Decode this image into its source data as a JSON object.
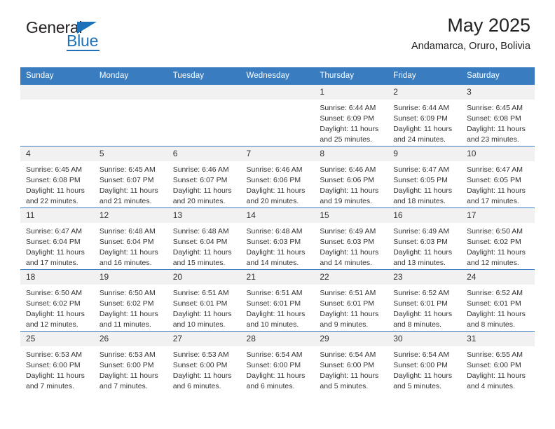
{
  "logo": {
    "word_top": "General",
    "word_bottom": "Blue",
    "triangle_color": "#1d71b8"
  },
  "header": {
    "title": "May 2025",
    "subtitle": "Andamarca, Oruro, Bolivia",
    "accent_color": "#3a7cc0"
  },
  "calendar": {
    "weekday_headers": [
      "Sunday",
      "Monday",
      "Tuesday",
      "Wednesday",
      "Thursday",
      "Friday",
      "Saturday"
    ],
    "weeks": [
      [
        {
          "day": "",
          "lines": []
        },
        {
          "day": "",
          "lines": []
        },
        {
          "day": "",
          "lines": []
        },
        {
          "day": "",
          "lines": []
        },
        {
          "day": "1",
          "lines": [
            "Sunrise: 6:44 AM",
            "Sunset: 6:09 PM",
            "Daylight: 11 hours",
            "and 25 minutes."
          ]
        },
        {
          "day": "2",
          "lines": [
            "Sunrise: 6:44 AM",
            "Sunset: 6:09 PM",
            "Daylight: 11 hours",
            "and 24 minutes."
          ]
        },
        {
          "day": "3",
          "lines": [
            "Sunrise: 6:45 AM",
            "Sunset: 6:08 PM",
            "Daylight: 11 hours",
            "and 23 minutes."
          ]
        }
      ],
      [
        {
          "day": "4",
          "lines": [
            "Sunrise: 6:45 AM",
            "Sunset: 6:08 PM",
            "Daylight: 11 hours",
            "and 22 minutes."
          ]
        },
        {
          "day": "5",
          "lines": [
            "Sunrise: 6:45 AM",
            "Sunset: 6:07 PM",
            "Daylight: 11 hours",
            "and 21 minutes."
          ]
        },
        {
          "day": "6",
          "lines": [
            "Sunrise: 6:46 AM",
            "Sunset: 6:07 PM",
            "Daylight: 11 hours",
            "and 20 minutes."
          ]
        },
        {
          "day": "7",
          "lines": [
            "Sunrise: 6:46 AM",
            "Sunset: 6:06 PM",
            "Daylight: 11 hours",
            "and 20 minutes."
          ]
        },
        {
          "day": "8",
          "lines": [
            "Sunrise: 6:46 AM",
            "Sunset: 6:06 PM",
            "Daylight: 11 hours",
            "and 19 minutes."
          ]
        },
        {
          "day": "9",
          "lines": [
            "Sunrise: 6:47 AM",
            "Sunset: 6:05 PM",
            "Daylight: 11 hours",
            "and 18 minutes."
          ]
        },
        {
          "day": "10",
          "lines": [
            "Sunrise: 6:47 AM",
            "Sunset: 6:05 PM",
            "Daylight: 11 hours",
            "and 17 minutes."
          ]
        }
      ],
      [
        {
          "day": "11",
          "lines": [
            "Sunrise: 6:47 AM",
            "Sunset: 6:04 PM",
            "Daylight: 11 hours",
            "and 17 minutes."
          ]
        },
        {
          "day": "12",
          "lines": [
            "Sunrise: 6:48 AM",
            "Sunset: 6:04 PM",
            "Daylight: 11 hours",
            "and 16 minutes."
          ]
        },
        {
          "day": "13",
          "lines": [
            "Sunrise: 6:48 AM",
            "Sunset: 6:04 PM",
            "Daylight: 11 hours",
            "and 15 minutes."
          ]
        },
        {
          "day": "14",
          "lines": [
            "Sunrise: 6:48 AM",
            "Sunset: 6:03 PM",
            "Daylight: 11 hours",
            "and 14 minutes."
          ]
        },
        {
          "day": "15",
          "lines": [
            "Sunrise: 6:49 AM",
            "Sunset: 6:03 PM",
            "Daylight: 11 hours",
            "and 14 minutes."
          ]
        },
        {
          "day": "16",
          "lines": [
            "Sunrise: 6:49 AM",
            "Sunset: 6:03 PM",
            "Daylight: 11 hours",
            "and 13 minutes."
          ]
        },
        {
          "day": "17",
          "lines": [
            "Sunrise: 6:50 AM",
            "Sunset: 6:02 PM",
            "Daylight: 11 hours",
            "and 12 minutes."
          ]
        }
      ],
      [
        {
          "day": "18",
          "lines": [
            "Sunrise: 6:50 AM",
            "Sunset: 6:02 PM",
            "Daylight: 11 hours",
            "and 12 minutes."
          ]
        },
        {
          "day": "19",
          "lines": [
            "Sunrise: 6:50 AM",
            "Sunset: 6:02 PM",
            "Daylight: 11 hours",
            "and 11 minutes."
          ]
        },
        {
          "day": "20",
          "lines": [
            "Sunrise: 6:51 AM",
            "Sunset: 6:01 PM",
            "Daylight: 11 hours",
            "and 10 minutes."
          ]
        },
        {
          "day": "21",
          "lines": [
            "Sunrise: 6:51 AM",
            "Sunset: 6:01 PM",
            "Daylight: 11 hours",
            "and 10 minutes."
          ]
        },
        {
          "day": "22",
          "lines": [
            "Sunrise: 6:51 AM",
            "Sunset: 6:01 PM",
            "Daylight: 11 hours",
            "and 9 minutes."
          ]
        },
        {
          "day": "23",
          "lines": [
            "Sunrise: 6:52 AM",
            "Sunset: 6:01 PM",
            "Daylight: 11 hours",
            "and 8 minutes."
          ]
        },
        {
          "day": "24",
          "lines": [
            "Sunrise: 6:52 AM",
            "Sunset: 6:01 PM",
            "Daylight: 11 hours",
            "and 8 minutes."
          ]
        }
      ],
      [
        {
          "day": "25",
          "lines": [
            "Sunrise: 6:53 AM",
            "Sunset: 6:00 PM",
            "Daylight: 11 hours",
            "and 7 minutes."
          ]
        },
        {
          "day": "26",
          "lines": [
            "Sunrise: 6:53 AM",
            "Sunset: 6:00 PM",
            "Daylight: 11 hours",
            "and 7 minutes."
          ]
        },
        {
          "day": "27",
          "lines": [
            "Sunrise: 6:53 AM",
            "Sunset: 6:00 PM",
            "Daylight: 11 hours",
            "and 6 minutes."
          ]
        },
        {
          "day": "28",
          "lines": [
            "Sunrise: 6:54 AM",
            "Sunset: 6:00 PM",
            "Daylight: 11 hours",
            "and 6 minutes."
          ]
        },
        {
          "day": "29",
          "lines": [
            "Sunrise: 6:54 AM",
            "Sunset: 6:00 PM",
            "Daylight: 11 hours",
            "and 5 minutes."
          ]
        },
        {
          "day": "30",
          "lines": [
            "Sunrise: 6:54 AM",
            "Sunset: 6:00 PM",
            "Daylight: 11 hours",
            "and 5 minutes."
          ]
        },
        {
          "day": "31",
          "lines": [
            "Sunrise: 6:55 AM",
            "Sunset: 6:00 PM",
            "Daylight: 11 hours",
            "and 4 minutes."
          ]
        }
      ]
    ]
  }
}
